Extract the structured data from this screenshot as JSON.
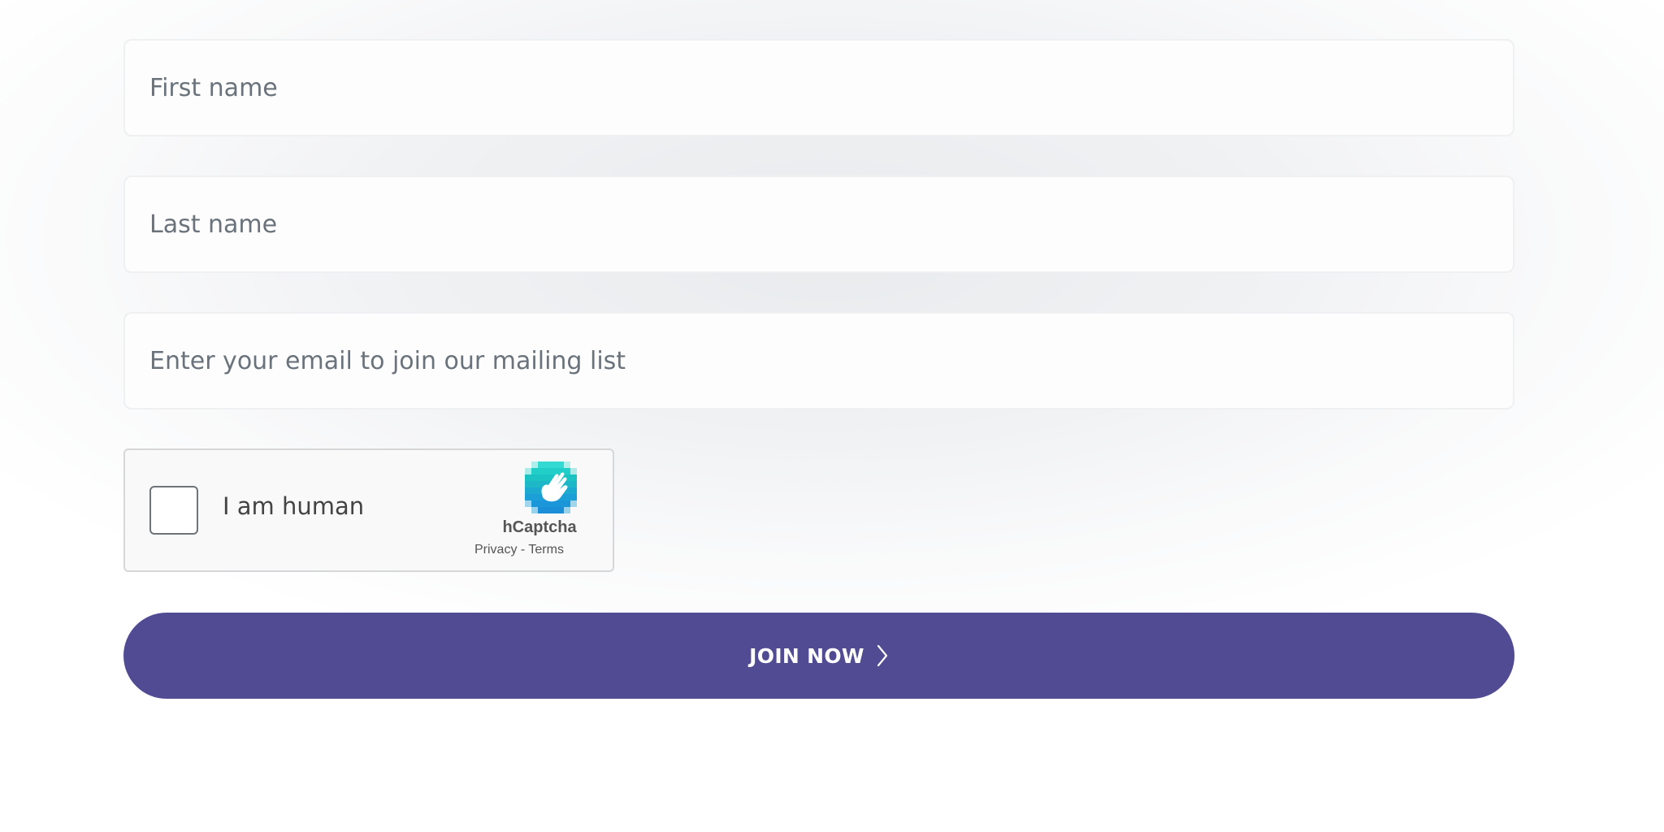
{
  "form": {
    "first_name": {
      "placeholder": "First name",
      "value": ""
    },
    "last_name": {
      "placeholder": "Last name",
      "value": ""
    },
    "email": {
      "placeholder": "Enter your email to join our mailing list",
      "value": ""
    }
  },
  "captcha": {
    "checkbox_label": "I am human",
    "checked": false,
    "brand": "hCaptcha",
    "privacy_label": "Privacy",
    "separator": " - ",
    "terms_label": "Terms",
    "icon": "hcaptcha-hand-icon"
  },
  "submit": {
    "label": "JOIN NOW",
    "icon": "chevron-right-icon"
  },
  "colors": {
    "button": "#514b93",
    "button_text": "#ffffff",
    "placeholder": "#6a737b",
    "captcha_teal": "#1fc9c0",
    "captcha_blue": "#1a9fd8"
  }
}
